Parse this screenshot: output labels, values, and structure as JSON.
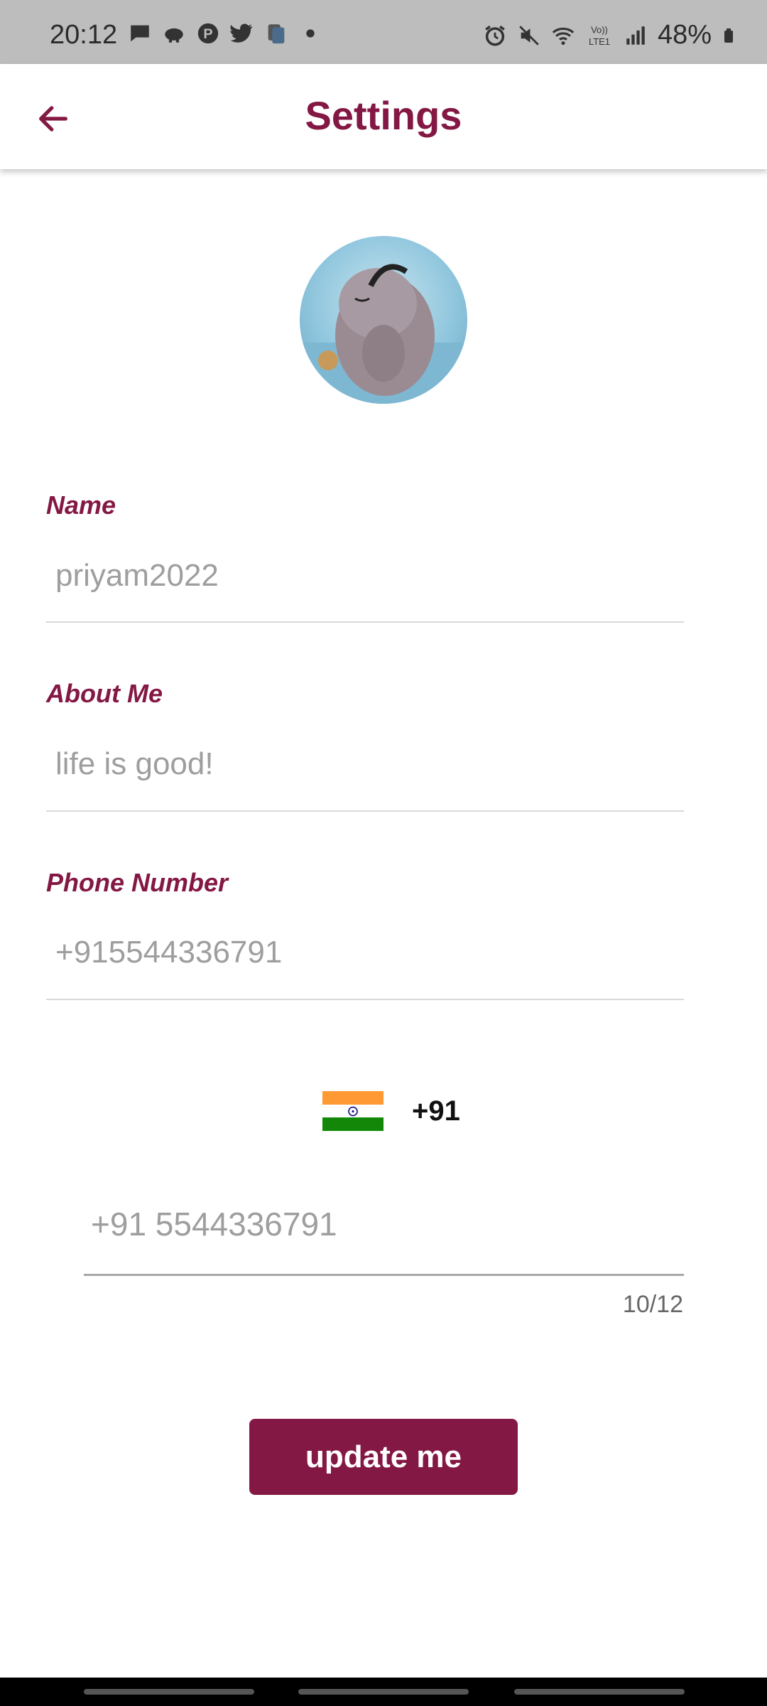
{
  "status_bar": {
    "time": "20:12",
    "battery": "48%",
    "left_icons": [
      "chat-icon",
      "piggy-icon",
      "pinterest-icon",
      "twitter-icon",
      "cards-icon",
      "dot-icon"
    ],
    "right_icons": [
      "alarm-icon",
      "mute-icon",
      "wifi-icon",
      "volte-icon",
      "signal-icon",
      "battery-icon"
    ],
    "volte_label": "Vo)) LTE1"
  },
  "app_bar": {
    "title": "Settings",
    "back_icon": "arrow-left-icon"
  },
  "profile": {
    "avatar": "profile-photo"
  },
  "fields": {
    "name_label": "Name",
    "name_value": "priyam2022",
    "about_label": "About Me",
    "about_value": "life is good!",
    "phone_label": "Phone Number",
    "phone_value": "+915544336791"
  },
  "country_picker": {
    "flag": "india-flag-icon",
    "code": "+91"
  },
  "phone_input": {
    "placeholder": "+91 5544336791",
    "counter": "10/12"
  },
  "update_button": {
    "label": "update me"
  },
  "colors": {
    "accent": "#841844",
    "status_bar": "#bdbdbd"
  }
}
